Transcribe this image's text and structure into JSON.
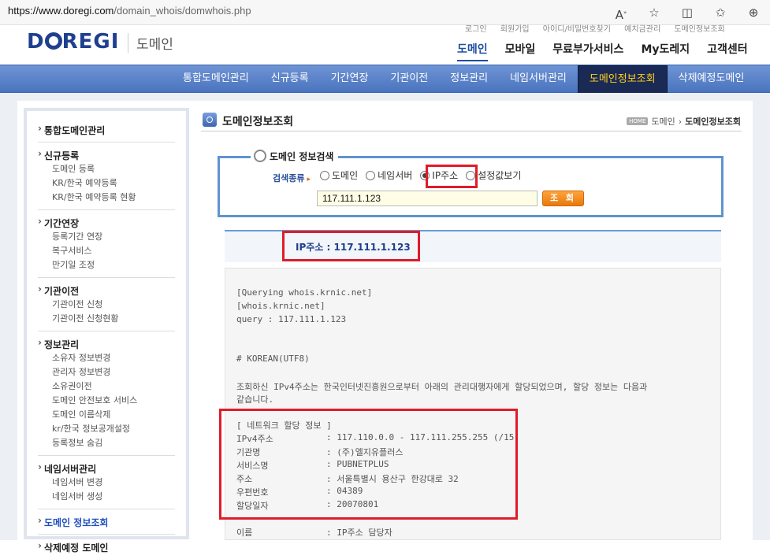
{
  "browser": {
    "url_host": "https://www.doregi.com",
    "url_path": "/domain_whois/domwhois.php",
    "icons": [
      "read-aloud-icon",
      "favorite-star-icon",
      "split-screen-icon",
      "favorites-icon",
      "collections-icon"
    ]
  },
  "header": {
    "logo_text": "D",
    "logo_text2": "REGI",
    "logo_sub": "도메인",
    "util_links": [
      "로그인",
      "회원가입",
      "아이디/비밀번호찾기",
      "예치금관리",
      "도메인정보조회"
    ],
    "main_nav": [
      "도메인",
      "모바일",
      "무료부가서비스",
      "My도레지",
      "고객센터"
    ],
    "main_nav_active": "도메인"
  },
  "subnav": {
    "items": [
      "통합도메인관리",
      "신규등록",
      "기간연장",
      "기관이전",
      "정보관리",
      "네임서버관리",
      "도메인정보조회",
      "삭제예정도메인"
    ],
    "active": "도메인정보조회"
  },
  "sidebar": {
    "groups": [
      {
        "head": "통합도메인관리",
        "subs": []
      },
      {
        "head": "신규등록",
        "subs": [
          "도메인 등록",
          "KR/한국 예약등록",
          "KR/한국 예약등록 현황"
        ]
      },
      {
        "head": "기간연장",
        "subs": [
          "등록기간 연장",
          "복구서비스",
          "만기일 조정"
        ]
      },
      {
        "head": "기관이전",
        "subs": [
          "기관이전 신청",
          "기관이전 신청현황"
        ]
      },
      {
        "head": "정보관리",
        "subs": [
          "소유자 정보변경",
          "관리자 정보변경",
          "소유권이전",
          "도메인 안전보호 서비스",
          "도메인 이름삭제",
          "kr/한국 정보공개설정",
          "등록정보 숨김"
        ]
      },
      {
        "head": "네임서버관리",
        "subs": [
          "네임서버 변경",
          "네임서버 생성"
        ]
      },
      {
        "head": "도메인 정보조회",
        "subs": []
      },
      {
        "head": "삭제예정 도메인",
        "subs": []
      }
    ]
  },
  "content": {
    "title": "도메인정보조회",
    "breadcrumb": {
      "home": "HOME",
      "parent": "도메인",
      "current": "도메인정보조회"
    }
  },
  "search": {
    "legend": "도메인 정보검색",
    "type_label": "검색종류",
    "radios": [
      {
        "label": "도메인",
        "checked": false
      },
      {
        "label": "네임서버",
        "checked": false
      },
      {
        "label": "IP주소",
        "checked": true
      },
      {
        "label": "설정값보기",
        "checked": false
      }
    ],
    "query": "117.111.1.123",
    "button": "조 회"
  },
  "result": {
    "ip_header": "IP주소 : 117.111.1.123",
    "lines": [
      "[Querying whois.krnic.net]",
      "[whois.krnic.net]",
      "query : 117.111.1.123",
      "# KOREAN(UTF8)",
      "조회하신 IPv4주소는 한국인터넷진흥원으로부터 아래의 관리대행자에게 할당되었으며, 할당 정보는 다음과",
      "같습니다.",
      "[ 네트워크 할당 정보 ]"
    ],
    "network": [
      {
        "k": "IPv4주소",
        "v": ": 117.110.0.0 - 117.111.255.255 (/15)"
      },
      {
        "k": "기관명",
        "v": ": (주)엘지유플러스"
      },
      {
        "k": "서비스명",
        "v": ": PUBNETPLUS"
      },
      {
        "k": "주소",
        "v": ": 서울특별시 용산구 한강대로 32"
      },
      {
        "k": "우편번호",
        "v": ": 04389"
      },
      {
        "k": "할당일자",
        "v": ": 20070801"
      },
      {
        "k": "이름",
        "v": ": IP주소 담당자"
      }
    ]
  }
}
